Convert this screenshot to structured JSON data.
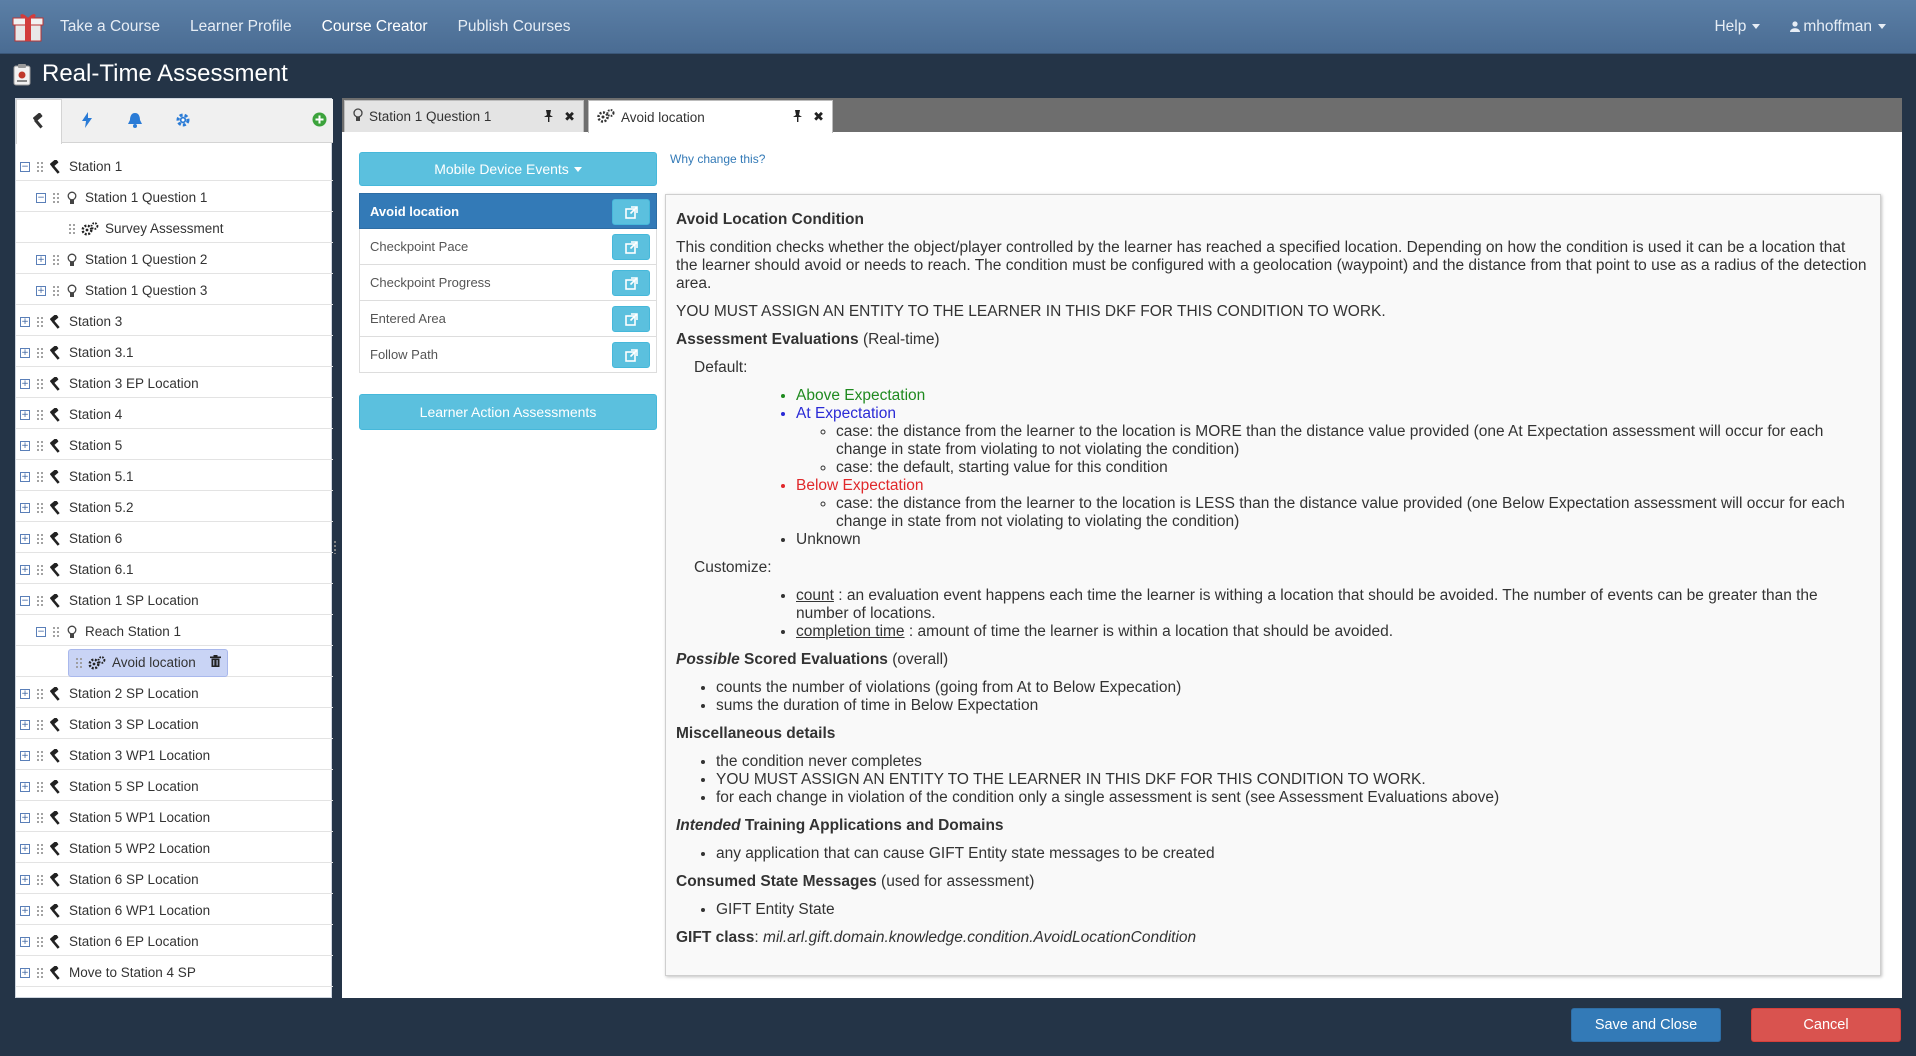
{
  "navbar": {
    "links": [
      "Take a Course",
      "Learner Profile",
      "Course Creator",
      "Publish Courses"
    ],
    "help": "Help",
    "user": "mhoffman"
  },
  "modal": {
    "title": "Real-Time Assessment"
  },
  "tree": {
    "tool_tab_icons": [
      "hammer-icon",
      "lightning-icon",
      "bell-icon",
      "gear-icon",
      "add-icon"
    ],
    "rows": [
      {
        "label": "Station 1",
        "expander": "⊟",
        "depth": 0,
        "icon": "hammer-icon"
      },
      {
        "label": "Station 1 Question 1",
        "expander": "⊟",
        "depth": 1,
        "icon": "lightbulb-icon"
      },
      {
        "label": "Survey Assessment",
        "expander": "",
        "depth": 2,
        "icon": "gears-icon"
      },
      {
        "label": "Station 1 Question 2",
        "expander": "⊞",
        "depth": 1,
        "icon": "lightbulb-icon"
      },
      {
        "label": "Station 1 Question 3",
        "expander": "⊞",
        "depth": 1,
        "icon": "lightbulb-icon"
      },
      {
        "label": "Station 3",
        "expander": "⊞",
        "depth": 0,
        "icon": "hammer-icon"
      },
      {
        "label": "Station 3.1",
        "expander": "⊞",
        "depth": 0,
        "icon": "hammer-icon"
      },
      {
        "label": "Station 3 EP Location",
        "expander": "⊞",
        "depth": 0,
        "icon": "hammer-icon"
      },
      {
        "label": "Station 4",
        "expander": "⊞",
        "depth": 0,
        "icon": "hammer-icon"
      },
      {
        "label": "Station 5",
        "expander": "⊞",
        "depth": 0,
        "icon": "hammer-icon"
      },
      {
        "label": "Station 5.1",
        "expander": "⊞",
        "depth": 0,
        "icon": "hammer-icon"
      },
      {
        "label": "Station 5.2",
        "expander": "⊞",
        "depth": 0,
        "icon": "hammer-icon"
      },
      {
        "label": "Station 6",
        "expander": "⊞",
        "depth": 0,
        "icon": "hammer-icon"
      },
      {
        "label": "Station 6.1",
        "expander": "⊞",
        "depth": 0,
        "icon": "hammer-icon"
      },
      {
        "label": "Station 1 SP Location",
        "expander": "⊟",
        "depth": 0,
        "icon": "hammer-icon"
      },
      {
        "label": "Reach Station 1",
        "expander": "⊟",
        "depth": 1,
        "icon": "lightbulb-icon"
      },
      {
        "label": "Avoid location",
        "expander": "",
        "depth": 2,
        "icon": "gears-icon",
        "selected": true
      },
      {
        "label": "Station 2 SP Location",
        "expander": "⊞",
        "depth": 0,
        "icon": "hammer-icon"
      },
      {
        "label": "Station 3 SP Location",
        "expander": "⊞",
        "depth": 0,
        "icon": "hammer-icon"
      },
      {
        "label": "Station 3 WP1 Location",
        "expander": "⊞",
        "depth": 0,
        "icon": "hammer-icon"
      },
      {
        "label": "Station 5 SP Location",
        "expander": "⊞",
        "depth": 0,
        "icon": "hammer-icon"
      },
      {
        "label": "Station 5 WP1 Location",
        "expander": "⊞",
        "depth": 0,
        "icon": "hammer-icon"
      },
      {
        "label": "Station 5 WP2 Location",
        "expander": "⊞",
        "depth": 0,
        "icon": "hammer-icon"
      },
      {
        "label": "Station 6 SP Location",
        "expander": "⊞",
        "depth": 0,
        "icon": "hammer-icon"
      },
      {
        "label": "Station 6 WP1 Location",
        "expander": "⊞",
        "depth": 0,
        "icon": "hammer-icon"
      },
      {
        "label": "Station 6 EP Location",
        "expander": "⊞",
        "depth": 0,
        "icon": "hammer-icon"
      },
      {
        "label": "Move to Station 4 SP",
        "expander": "⊞",
        "depth": 0,
        "icon": "hammer-icon"
      }
    ]
  },
  "tabs": [
    {
      "label": "Station 1 Question 1",
      "icon": "lightbulb-icon"
    },
    {
      "label": "Avoid location",
      "icon": "gears-icon"
    }
  ],
  "conditions": {
    "dropdown_label": "Mobile Device Events",
    "items": [
      "Avoid location",
      "Checkpoint Pace",
      "Checkpoint Progress",
      "Entered Area",
      "Follow Path"
    ],
    "active": "Avoid location",
    "learner_action_label": "Learner Action Assessments",
    "why_link": "Why change this?"
  },
  "doc": {
    "title": "Avoid Location Condition",
    "description": "This condition checks whether the object/player controlled by the learner has reached a specified location.  Depending on how the condition is used it can be a location that the learner should avoid or needs to reach.  The condition must be configured with a geolocation (waypoint) and the distance from that point to use as a radius of the detection area.",
    "warning": "YOU MUST ASSIGN AN ENTITY TO THE LEARNER IN THIS DKF FOR THIS CONDITION TO WORK.",
    "assess_heading": "Assessment Evaluations",
    "assess_sub": "(Real-time)",
    "default_label": "Default:",
    "above": "Above Expectation",
    "at": "At Expectation",
    "at_case1": "case: the distance from the learner to the location is MORE than the distance value provided (one At Expectation assessment will occur for each change in state from violating to not violating the condition)",
    "at_case2": "case: the default, starting value for this condition",
    "below": "Below Expectation",
    "below_case1": "case: the distance from the learner to the location is LESS than the distance value provided (one Below Expectation assessment will occur for each change in state from not violating to violating the condition)",
    "unknown": "Unknown",
    "customize_label": "Customize:",
    "count_term": "count",
    "count_desc": " : an evaluation event happens each time the learner is withing a location that should be avoided.  The number of events can be greater than the number of locations.",
    "completion_term": "completion time",
    "completion_desc": " : amount of time the learner is within a location that should be avoided.",
    "possible_it": "Possible",
    "possible_heading": " Scored Evaluations",
    "possible_sub": "(overall)",
    "possible_items": [
      "counts the number of violations (going from At to Below Expecation)",
      "sums the duration of time in Below Expectation"
    ],
    "misc_heading": "Miscellaneous details",
    "misc_items": [
      "the condition never completes",
      "YOU MUST ASSIGN AN ENTITY TO THE LEARNER IN THIS DKF FOR THIS CONDITION TO WORK.",
      "for each change in violation of the condition only a single assessment is sent (see Assessment Evaluations above)"
    ],
    "intended_it": "Intended",
    "intended_heading": " Training Applications and Domains",
    "intended_items": [
      "any application that can cause GIFT Entity state messages to be created"
    ],
    "consumed_heading": "Consumed State Messages",
    "consumed_sub": "(used for assessment)",
    "consumed_items": [
      "GIFT Entity State"
    ],
    "class_label": "GIFT class",
    "class_value": "mil.arl.gift.domain.knowledge.condition.AvoidLocationCondition"
  },
  "footer": {
    "save": "Save and Close",
    "cancel": "Cancel"
  }
}
